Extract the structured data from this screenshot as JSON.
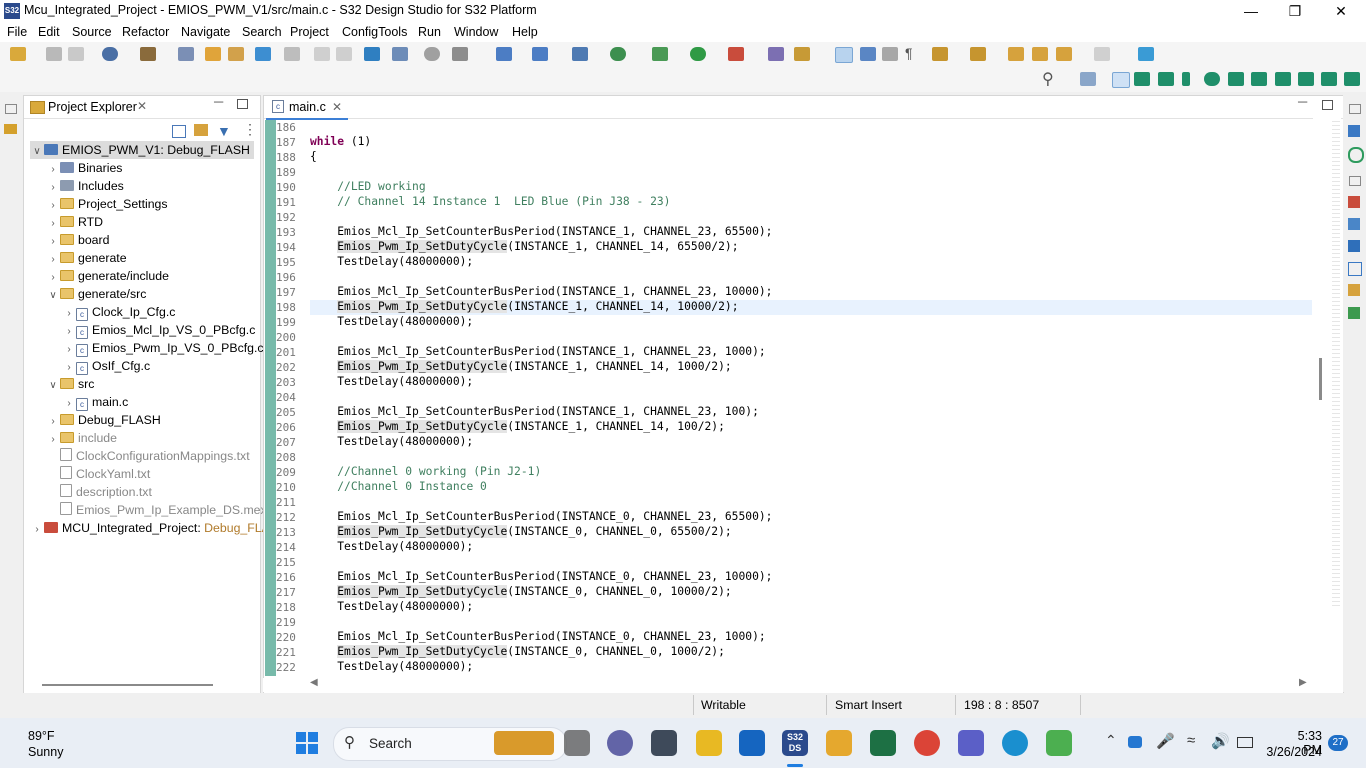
{
  "window": {
    "title": "Mcu_Integrated_Project - EMIOS_PWM_V1/src/main.c - S32 Design Studio for S32 Platform",
    "app_icon_label": "S32"
  },
  "menu": [
    "File",
    "Edit",
    "Source",
    "Refactor",
    "Navigate",
    "Search",
    "Project",
    "ConfigTools",
    "Run",
    "Window",
    "Help"
  ],
  "explorer": {
    "tab_label": "Project Explorer",
    "tree": [
      {
        "label": "EMIOS_PWM_V1: Debug_FLASH",
        "depth": 0,
        "twisty": "open",
        "icon": "project",
        "selected": true
      },
      {
        "label": "Binaries",
        "depth": 1,
        "twisty": "closed",
        "icon": "binaries"
      },
      {
        "label": "Includes",
        "depth": 1,
        "twisty": "closed",
        "icon": "includes"
      },
      {
        "label": "Project_Settings",
        "depth": 1,
        "twisty": "closed",
        "icon": "folder"
      },
      {
        "label": "RTD",
        "depth": 1,
        "twisty": "closed",
        "icon": "folder"
      },
      {
        "label": "board",
        "depth": 1,
        "twisty": "closed",
        "icon": "folder"
      },
      {
        "label": "generate",
        "depth": 1,
        "twisty": "closed",
        "icon": "folder"
      },
      {
        "label": "generate/include",
        "depth": 1,
        "twisty": "closed",
        "icon": "folder"
      },
      {
        "label": "generate/src",
        "depth": 1,
        "twisty": "open",
        "icon": "folder"
      },
      {
        "label": "Clock_Ip_Cfg.c",
        "depth": 2,
        "twisty": "closed",
        "icon": "cfile"
      },
      {
        "label": "Emios_Mcl_Ip_VS_0_PBcfg.c",
        "depth": 2,
        "twisty": "closed",
        "icon": "cfile"
      },
      {
        "label": "Emios_Pwm_Ip_VS_0_PBcfg.c",
        "depth": 2,
        "twisty": "closed",
        "icon": "cfile"
      },
      {
        "label": "OsIf_Cfg.c",
        "depth": 2,
        "twisty": "closed",
        "icon": "cfile"
      },
      {
        "label": "src",
        "depth": 1,
        "twisty": "open",
        "icon": "folder"
      },
      {
        "label": "main.c",
        "depth": 2,
        "twisty": "closed",
        "icon": "cfile"
      },
      {
        "label": "Debug_FLASH",
        "depth": 1,
        "twisty": "closed",
        "icon": "folder"
      },
      {
        "label": "include",
        "depth": 1,
        "twisty": "closed",
        "icon": "folder",
        "dim": true
      },
      {
        "label": "ClockConfigurationMappings.txt",
        "depth": 1,
        "twisty": "none",
        "icon": "txt",
        "dim": true
      },
      {
        "label": "ClockYaml.txt",
        "depth": 1,
        "twisty": "none",
        "icon": "txt",
        "dim": true
      },
      {
        "label": "description.txt",
        "depth": 1,
        "twisty": "none",
        "icon": "txt",
        "dim": true
      },
      {
        "label": "Emios_Pwm_Ip_Example_DS.mex",
        "depth": 1,
        "twisty": "none",
        "icon": "txt",
        "dim": true
      },
      {
        "label": "MCU_Integrated_Project:",
        "suffix": " Debug_FLA",
        "depth": 0,
        "twisty": "closed",
        "icon": "project-err"
      }
    ]
  },
  "editor": {
    "tab_label": "main.c",
    "current_line": 198,
    "lines": [
      {
        "n": "186",
        "t": ""
      },
      {
        "n": "187",
        "t": "while (1)"
      },
      {
        "n": "188",
        "t": "{"
      },
      {
        "n": "189",
        "t": ""
      },
      {
        "n": "190",
        "t": "    //LED working"
      },
      {
        "n": "191",
        "t": "    // Channel 14 Instance 1  LED Blue (Pin J38 - 23)"
      },
      {
        "n": "192",
        "t": ""
      },
      {
        "n": "193",
        "t": "    Emios_Mcl_Ip_SetCounterBusPeriod(INSTANCE_1, CHANNEL_23, 65500);"
      },
      {
        "n": "194",
        "t": "    Emios_Pwm_Ip_SetDutyCycle(INSTANCE_1, CHANNEL_14, 65500/2);"
      },
      {
        "n": "195",
        "t": "    TestDelay(48000000);"
      },
      {
        "n": "196",
        "t": ""
      },
      {
        "n": "197",
        "t": "    Emios_Mcl_Ip_SetCounterBusPeriod(INSTANCE_1, CHANNEL_23, 10000);"
      },
      {
        "n": "198",
        "t": "    Emios_Pwm_Ip_SetDutyCycle(INSTANCE_1, CHANNEL_14, 10000/2);"
      },
      {
        "n": "199",
        "t": "    TestDelay(48000000);"
      },
      {
        "n": "200",
        "t": ""
      },
      {
        "n": "201",
        "t": "    Emios_Mcl_Ip_SetCounterBusPeriod(INSTANCE_1, CHANNEL_23, 1000);"
      },
      {
        "n": "202",
        "t": "    Emios_Pwm_Ip_SetDutyCycle(INSTANCE_1, CHANNEL_14, 1000/2);"
      },
      {
        "n": "203",
        "t": "    TestDelay(48000000);"
      },
      {
        "n": "204",
        "t": ""
      },
      {
        "n": "205",
        "t": "    Emios_Mcl_Ip_SetCounterBusPeriod(INSTANCE_1, CHANNEL_23, 100);"
      },
      {
        "n": "206",
        "t": "    Emios_Pwm_Ip_SetDutyCycle(INSTANCE_1, CHANNEL_14, 100/2);"
      },
      {
        "n": "207",
        "t": "    TestDelay(48000000);"
      },
      {
        "n": "208",
        "t": ""
      },
      {
        "n": "209",
        "t": "    //Channel 0 working (Pin J2-1)"
      },
      {
        "n": "210",
        "t": "    //Channel 0 Instance 0"
      },
      {
        "n": "211",
        "t": ""
      },
      {
        "n": "212",
        "t": "    Emios_Mcl_Ip_SetCounterBusPeriod(INSTANCE_0, CHANNEL_23, 65500);"
      },
      {
        "n": "213",
        "t": "    Emios_Pwm_Ip_SetDutyCycle(INSTANCE_0, CHANNEL_0, 65500/2);"
      },
      {
        "n": "214",
        "t": "    TestDelay(48000000);"
      },
      {
        "n": "215",
        "t": ""
      },
      {
        "n": "216",
        "t": "    Emios_Mcl_Ip_SetCounterBusPeriod(INSTANCE_0, CHANNEL_23, 10000);"
      },
      {
        "n": "217",
        "t": "    Emios_Pwm_Ip_SetDutyCycle(INSTANCE_0, CHANNEL_0, 10000/2);"
      },
      {
        "n": "218",
        "t": "    TestDelay(48000000);"
      },
      {
        "n": "219",
        "t": ""
      },
      {
        "n": "220",
        "t": "    Emios_Mcl_Ip_SetCounterBusPeriod(INSTANCE_0, CHANNEL_23, 1000);"
      },
      {
        "n": "221",
        "t": "    Emios_Pwm_Ip_SetDutyCycle(INSTANCE_0, CHANNEL_0, 1000/2);"
      },
      {
        "n": "222",
        "t": "    TestDelay(48000000);"
      }
    ]
  },
  "status": {
    "writable": "Writable",
    "insert_mode": "Smart Insert",
    "position": "198 : 8 : 8507"
  },
  "taskbar": {
    "weather_temp": "89°F",
    "weather_desc": "Sunny",
    "search_label": "Search",
    "time": "5:33 PM",
    "date": "3/26/2024",
    "notification_count": "27",
    "app_label_s32": "S32\nDS"
  },
  "colors": {
    "keyword": "#7f0055",
    "comment": "#3f7f5f",
    "current_line": "#e8f2fe",
    "gutter_stripe": "#5fae9b"
  }
}
